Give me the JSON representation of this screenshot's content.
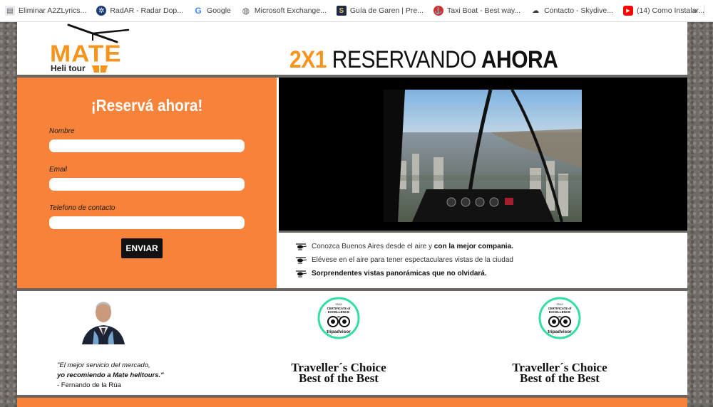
{
  "bookmarks": [
    {
      "label": "Eliminar A2ZLyrics...",
      "icon": "folder-icon"
    },
    {
      "label": "RadAR - Radar Dop...",
      "icon": "radar-icon"
    },
    {
      "label": "Google",
      "icon": "google-icon"
    },
    {
      "label": "Microsoft Exchange...",
      "icon": "globe-icon"
    },
    {
      "label": "Guía de Garen | Pre...",
      "icon": "garen-icon"
    },
    {
      "label": "Taxi Boat - Best way...",
      "icon": "taxiboat-icon"
    },
    {
      "label": "Contacto - Skydive...",
      "icon": "skydive-icon"
    },
    {
      "label": "(14) Como Instalar...",
      "icon": "youtube-icon"
    }
  ],
  "bookmarks_more": "»",
  "logo": {
    "title": "MATE",
    "subtitle": "Heli tour"
  },
  "headline": {
    "part1": "2X1",
    "part2": "RESERVANDO",
    "part3": "AHORA"
  },
  "form": {
    "title": "¡Reservá ahora!",
    "fields": [
      {
        "label": "Nombre",
        "value": ""
      },
      {
        "label": "Email",
        "value": ""
      },
      {
        "label": "Telefono de contacto",
        "value": ""
      }
    ],
    "submit_label": "ENVIAR"
  },
  "bullets": [
    {
      "text": "Conozca Buenos Aires desde el aire y ",
      "bold": "con la mejor compania."
    },
    {
      "text": "Elévese en el aire para tener espectaculares vistas de la ciudad",
      "bold": ""
    },
    {
      "text": "",
      "bold": "Sorprendentes vistas panorámicas que no olvidará."
    }
  ],
  "testimonial": {
    "line1": "\"El mejor servicio del mercado,",
    "line2": "yo recomiendo a Mate helitours.\"",
    "line3": "- Fernando de la Rúa"
  },
  "awards": [
    {
      "badge_year": "2019",
      "badge_title": "CERTIFICATE of EXCELLENCE",
      "badge_brand": "tripadvisor",
      "line1": "Traveller´s Choice",
      "line2": "Best of the Best"
    },
    {
      "badge_year": "2019",
      "badge_title": "CERTIFICATE of EXCELLENCE",
      "badge_brand": "tripadvisor",
      "line1": "Traveller´s Choice",
      "line2": "Best of the Best"
    }
  ],
  "colors": {
    "brand_orange": "#f7941d",
    "panel_orange": "#f7833a",
    "tripadvisor_green": "#34e0a1"
  }
}
